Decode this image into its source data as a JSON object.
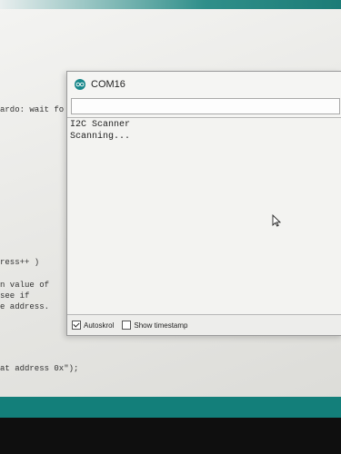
{
  "window": {
    "title": "COM16"
  },
  "ide": {
    "line1": "ardo: wait fo",
    "line2": "ress++ )",
    "line3": "n value of",
    "line4": "see if",
    "line5": "e address.",
    "line6": "at address 0x\");"
  },
  "serial": {
    "input_value": "",
    "output": [
      "I2C Scanner",
      "Scanning..."
    ]
  },
  "footer": {
    "autoscroll_label": "Autoskrol",
    "autoscroll_checked": true,
    "timestamp_label": "Show timestamp",
    "timestamp_checked": false
  },
  "colors": {
    "accent": "#17878a",
    "taskbar": "#137f7a"
  }
}
